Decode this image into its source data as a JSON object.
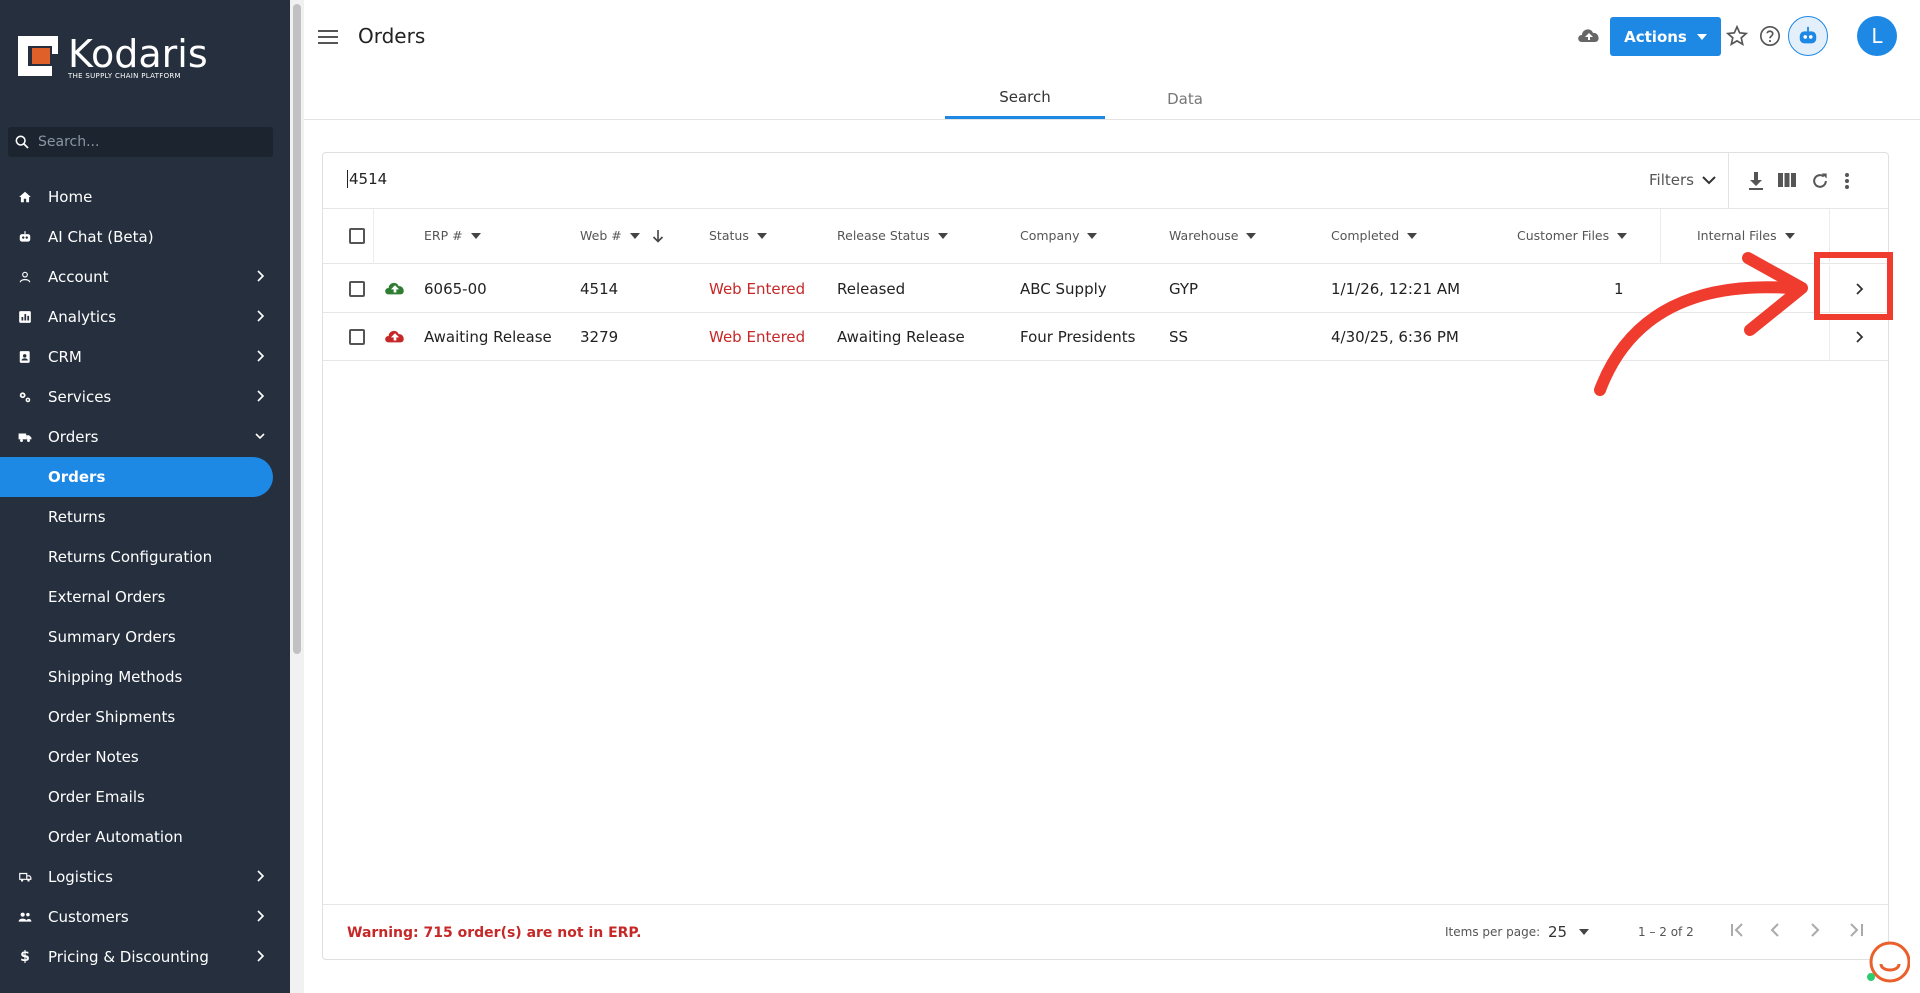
{
  "sidebar": {
    "brand": "Kodaris",
    "tagline": "THE SUPPLY CHAIN PLATFORM",
    "search_placeholder": "Search...",
    "items": [
      {
        "label": "Home",
        "icon": "home-icon",
        "expandable": false
      },
      {
        "label": "AI Chat (Beta)",
        "icon": "robot-icon",
        "expandable": false
      },
      {
        "label": "Account",
        "icon": "person-icon",
        "expandable": true
      },
      {
        "label": "Analytics",
        "icon": "analytics-icon",
        "expandable": true
      },
      {
        "label": "CRM",
        "icon": "contacts-icon",
        "expandable": true
      },
      {
        "label": "Services",
        "icon": "gears-icon",
        "expandable": true
      },
      {
        "label": "Orders",
        "icon": "truck-icon",
        "expandable": true,
        "expanded": true
      }
    ],
    "orders_sub": [
      "Orders",
      "Returns",
      "Returns Configuration",
      "External Orders",
      "Summary Orders",
      "Shipping Methods",
      "Order Shipments",
      "Order Notes",
      "Order Emails",
      "Order Automation"
    ],
    "active_sub": "Orders",
    "items_after": [
      {
        "label": "Logistics",
        "icon": "shipping-icon",
        "expandable": true
      },
      {
        "label": "Customers",
        "icon": "people-icon",
        "expandable": true
      },
      {
        "label": "Pricing & Discounting",
        "icon": "dollar-icon",
        "expandable": true
      }
    ]
  },
  "header": {
    "title": "Orders",
    "actions_label": "Actions",
    "avatar_initial": "L",
    "tabs": [
      "Search",
      "Data"
    ],
    "active_tab": "Search"
  },
  "search": {
    "query": "4514",
    "filters_label": "Filters"
  },
  "table": {
    "columns": [
      "ERP #",
      "Web #",
      "Status",
      "Release Status",
      "Company",
      "Warehouse",
      "Completed",
      "Customer Files",
      "Internal Files"
    ],
    "rows": [
      {
        "upload_status": "uploaded",
        "erp": "6065-00",
        "web": "4514",
        "status": "Web Entered",
        "release_status": "Released",
        "company": "ABC Supply",
        "warehouse": "GYP",
        "completed": "1/1/26, 12:21 AM",
        "customer_files": "1",
        "internal_files": ""
      },
      {
        "upload_status": "not-uploaded",
        "erp": "Awaiting Release",
        "web": "3279",
        "status": "Web Entered",
        "release_status": "Awaiting Release",
        "company": "Four Presidents",
        "warehouse": "SS",
        "completed": "4/30/25, 6:36 PM",
        "customer_files": "",
        "internal_files": ""
      }
    ]
  },
  "footer": {
    "warning": "Warning: 715 order(s) are not in ERP.",
    "items_per_page_label": "Items per page:",
    "items_per_page": "25",
    "range": "1 – 2 of 2"
  },
  "colors": {
    "sidebar_bg": "#252f3d",
    "accent": "#1e88e5",
    "status_red": "#c62828",
    "uploaded_green": "#2e7d32",
    "annotation_red": "#f03c2e"
  }
}
